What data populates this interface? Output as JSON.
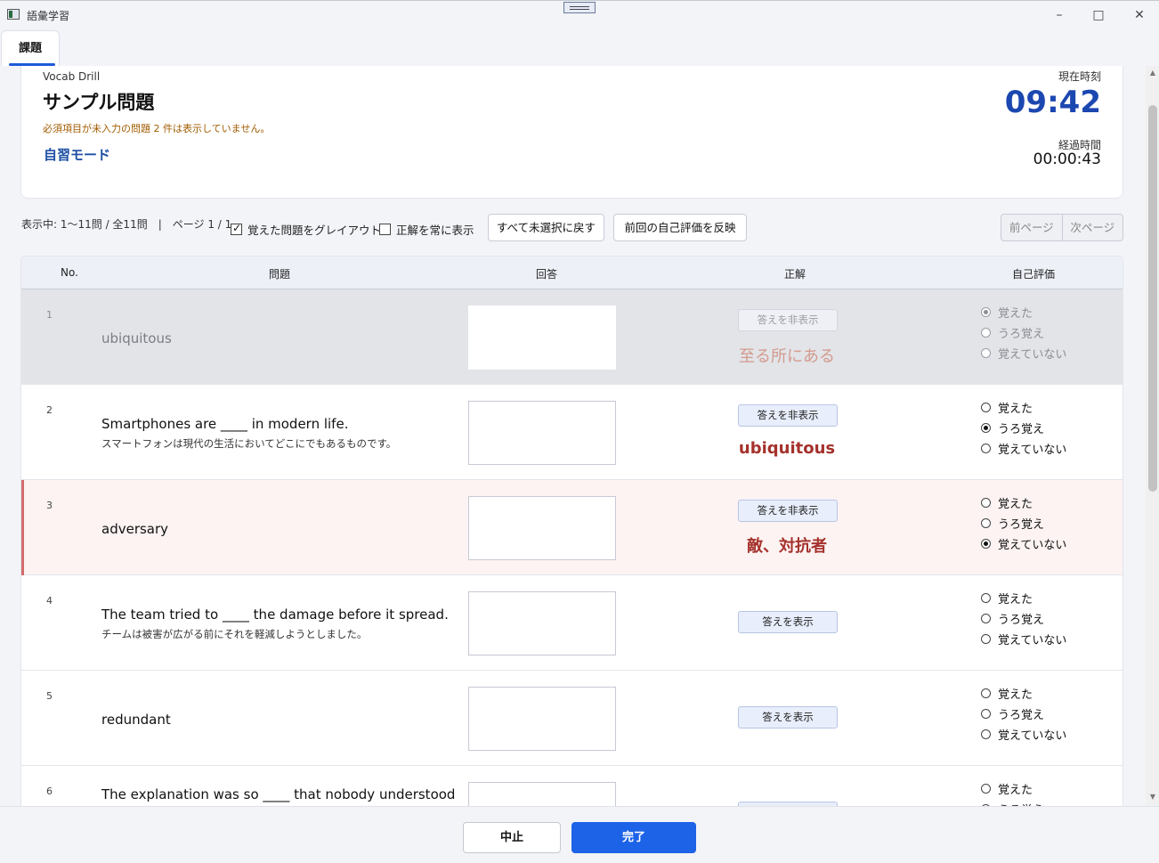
{
  "window": {
    "title": "語彙学習"
  },
  "tabs": [
    {
      "label": "課題"
    }
  ],
  "header": {
    "drill_label": "Vocab Drill",
    "title": "サンプル問題",
    "warning": "必須項目が未入力の問題 2 件は表示していません。",
    "mode": "自習モード",
    "clock_label": "現在時刻",
    "clock_value": "09:42",
    "elapsed_label": "経過時間",
    "elapsed_value": "00:00:43"
  },
  "toolbar": {
    "status": "表示中: 1〜11問 / 全11問　|　ページ 1 / 1",
    "grey_out_label": "覚えた問題をグレイアウト",
    "grey_out_checked": true,
    "always_show_label": "正解を常に表示",
    "always_show_checked": false,
    "reset_button": "すべて未選択に戻す",
    "apply_prev_button": "前回の自己評価を反映",
    "prev_page": "前ページ",
    "next_page": "次ページ"
  },
  "table": {
    "columns": [
      "No.",
      "問題",
      "回答",
      "正解",
      "自己評価"
    ],
    "options": [
      "覚えた",
      "うろ覚え",
      "覚えていない"
    ],
    "rows": [
      {
        "no": "1",
        "question": "ubiquitous",
        "sub": "",
        "button": "答えを非表示",
        "answer": "至る所にある",
        "rating": 0
      },
      {
        "no": "2",
        "question": "Smartphones are ____ in modern life.",
        "sub": "スマートフォンは現代の生活においてどこにでもあるものです。",
        "button": "答えを非表示",
        "answer": "ubiquitous",
        "rating": 1
      },
      {
        "no": "3",
        "question": "adversary",
        "sub": "",
        "button": "答えを非表示",
        "answer": "敵、対抗者",
        "rating": 2
      },
      {
        "no": "4",
        "question": "The team tried to ____ the damage before it spread.",
        "sub": "チームは被害が広がる前にそれを軽減しようとしました。",
        "button": "答えを表示",
        "answer": "",
        "rating": -1
      },
      {
        "no": "5",
        "question": "redundant",
        "sub": "",
        "button": "答えを表示",
        "answer": "",
        "rating": -1
      },
      {
        "no": "6",
        "question": "The explanation was so ____ that nobody understood",
        "sub": "",
        "button": "",
        "answer": "",
        "rating": -1
      }
    ]
  },
  "footer": {
    "cancel": "中止",
    "done": "完了"
  }
}
